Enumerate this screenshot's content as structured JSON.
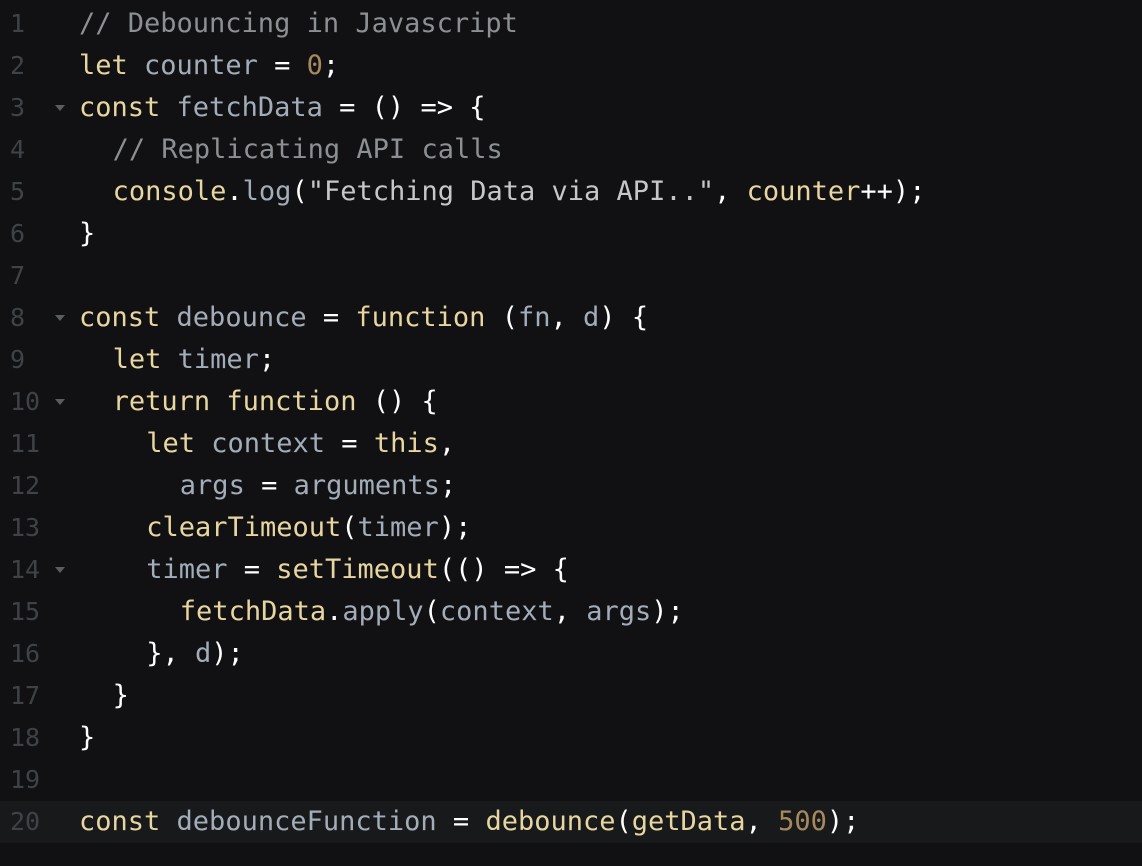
{
  "editor": {
    "language": "javascript",
    "active_line": 20,
    "fold_lines": [
      3,
      8,
      10,
      14
    ],
    "colors": {
      "background": "#111113",
      "keyword": "#e8d6a1",
      "identifier": "#a3acb9",
      "punctuation": "#ffffff",
      "comment": "#8c8f93",
      "number": "#a7895d",
      "gutter": "#3f4246"
    }
  },
  "lines": [
    {
      "n": "1",
      "indent": 0,
      "tokens": [
        {
          "t": "cm",
          "v": "// Debouncing in Javascript"
        }
      ]
    },
    {
      "n": "2",
      "indent": 0,
      "tokens": [
        {
          "t": "kw",
          "v": "let"
        },
        {
          "t": "sp",
          "v": " "
        },
        {
          "t": "var",
          "v": "counter"
        },
        {
          "t": "sp",
          "v": " "
        },
        {
          "t": "pn",
          "v": "="
        },
        {
          "t": "sp",
          "v": " "
        },
        {
          "t": "num",
          "v": "0"
        },
        {
          "t": "pn",
          "v": ";"
        }
      ]
    },
    {
      "n": "3",
      "indent": 0,
      "tokens": [
        {
          "t": "kw",
          "v": "const"
        },
        {
          "t": "sp",
          "v": " "
        },
        {
          "t": "var",
          "v": "fetchData"
        },
        {
          "t": "sp",
          "v": " "
        },
        {
          "t": "pn",
          "v": "="
        },
        {
          "t": "sp",
          "v": " "
        },
        {
          "t": "pn",
          "v": "()"
        },
        {
          "t": "sp",
          "v": " "
        },
        {
          "t": "pn",
          "v": "=>"
        },
        {
          "t": "sp",
          "v": " "
        },
        {
          "t": "pn",
          "v": "{"
        }
      ]
    },
    {
      "n": "4",
      "indent": 1,
      "tokens": [
        {
          "t": "cm",
          "v": "// Replicating API calls"
        }
      ]
    },
    {
      "n": "5",
      "indent": 1,
      "tokens": [
        {
          "t": "fn",
          "v": "console"
        },
        {
          "t": "pn",
          "v": "."
        },
        {
          "t": "prop",
          "v": "log"
        },
        {
          "t": "pn",
          "v": "("
        },
        {
          "t": "str",
          "v": "\"Fetching Data via API..\""
        },
        {
          "t": "pn",
          "v": ","
        },
        {
          "t": "sp",
          "v": " "
        },
        {
          "t": "fn",
          "v": "counter"
        },
        {
          "t": "pn",
          "v": "++);"
        }
      ]
    },
    {
      "n": "6",
      "indent": 0,
      "tokens": [
        {
          "t": "pn",
          "v": "}"
        }
      ]
    },
    {
      "n": "7",
      "indent": 0,
      "tokens": []
    },
    {
      "n": "8",
      "indent": 0,
      "tokens": [
        {
          "t": "kw",
          "v": "const"
        },
        {
          "t": "sp",
          "v": " "
        },
        {
          "t": "var",
          "v": "debounce"
        },
        {
          "t": "sp",
          "v": " "
        },
        {
          "t": "pn",
          "v": "="
        },
        {
          "t": "sp",
          "v": " "
        },
        {
          "t": "kw",
          "v": "function"
        },
        {
          "t": "sp",
          "v": " "
        },
        {
          "t": "pn",
          "v": "("
        },
        {
          "t": "var",
          "v": "fn"
        },
        {
          "t": "pn",
          "v": ","
        },
        {
          "t": "sp",
          "v": " "
        },
        {
          "t": "var",
          "v": "d"
        },
        {
          "t": "pn",
          "v": ")"
        },
        {
          "t": "sp",
          "v": " "
        },
        {
          "t": "pn",
          "v": "{"
        }
      ]
    },
    {
      "n": "9",
      "indent": 1,
      "tokens": [
        {
          "t": "kw",
          "v": "let"
        },
        {
          "t": "sp",
          "v": " "
        },
        {
          "t": "var",
          "v": "timer"
        },
        {
          "t": "pn",
          "v": ";"
        }
      ]
    },
    {
      "n": "10",
      "indent": 1,
      "tokens": [
        {
          "t": "kw",
          "v": "return"
        },
        {
          "t": "sp",
          "v": " "
        },
        {
          "t": "kw",
          "v": "function"
        },
        {
          "t": "sp",
          "v": " "
        },
        {
          "t": "pn",
          "v": "()"
        },
        {
          "t": "sp",
          "v": " "
        },
        {
          "t": "pn",
          "v": "{"
        }
      ]
    },
    {
      "n": "11",
      "indent": 2,
      "tokens": [
        {
          "t": "kw",
          "v": "let"
        },
        {
          "t": "sp",
          "v": " "
        },
        {
          "t": "var",
          "v": "context"
        },
        {
          "t": "sp",
          "v": " "
        },
        {
          "t": "pn",
          "v": "="
        },
        {
          "t": "sp",
          "v": " "
        },
        {
          "t": "kw",
          "v": "this"
        },
        {
          "t": "pn",
          "v": ","
        }
      ]
    },
    {
      "n": "12",
      "indent": 3,
      "tokens": [
        {
          "t": "var",
          "v": "args"
        },
        {
          "t": "sp",
          "v": " "
        },
        {
          "t": "pn",
          "v": "="
        },
        {
          "t": "sp",
          "v": " "
        },
        {
          "t": "var",
          "v": "arguments"
        },
        {
          "t": "pn",
          "v": ";"
        }
      ]
    },
    {
      "n": "13",
      "indent": 2,
      "tokens": [
        {
          "t": "fn",
          "v": "clearTimeout"
        },
        {
          "t": "pn",
          "v": "("
        },
        {
          "t": "var",
          "v": "timer"
        },
        {
          "t": "pn",
          "v": ");"
        }
      ]
    },
    {
      "n": "14",
      "indent": 2,
      "tokens": [
        {
          "t": "var",
          "v": "timer"
        },
        {
          "t": "sp",
          "v": " "
        },
        {
          "t": "pn",
          "v": "="
        },
        {
          "t": "sp",
          "v": " "
        },
        {
          "t": "fn",
          "v": "setTimeout"
        },
        {
          "t": "pn",
          "v": "(()"
        },
        {
          "t": "sp",
          "v": " "
        },
        {
          "t": "pn",
          "v": "=>"
        },
        {
          "t": "sp",
          "v": " "
        },
        {
          "t": "pn",
          "v": "{"
        }
      ]
    },
    {
      "n": "15",
      "indent": 3,
      "tokens": [
        {
          "t": "fn",
          "v": "fetchData"
        },
        {
          "t": "pn",
          "v": "."
        },
        {
          "t": "prop",
          "v": "apply"
        },
        {
          "t": "pn",
          "v": "("
        },
        {
          "t": "var",
          "v": "context"
        },
        {
          "t": "pn",
          "v": ","
        },
        {
          "t": "sp",
          "v": " "
        },
        {
          "t": "var",
          "v": "args"
        },
        {
          "t": "pn",
          "v": ");"
        }
      ]
    },
    {
      "n": "16",
      "indent": 2,
      "tokens": [
        {
          "t": "pn",
          "v": "},"
        },
        {
          "t": "sp",
          "v": " "
        },
        {
          "t": "var",
          "v": "d"
        },
        {
          "t": "pn",
          "v": ");"
        }
      ]
    },
    {
      "n": "17",
      "indent": 1,
      "tokens": [
        {
          "t": "pn",
          "v": "}"
        }
      ]
    },
    {
      "n": "18",
      "indent": 0,
      "tokens": [
        {
          "t": "pn",
          "v": "}"
        }
      ]
    },
    {
      "n": "19",
      "indent": 0,
      "tokens": []
    },
    {
      "n": "20",
      "indent": 0,
      "tokens": [
        {
          "t": "kw",
          "v": "const"
        },
        {
          "t": "sp",
          "v": " "
        },
        {
          "t": "var",
          "v": "debounceFunction"
        },
        {
          "t": "sp",
          "v": " "
        },
        {
          "t": "pn",
          "v": "="
        },
        {
          "t": "sp",
          "v": " "
        },
        {
          "t": "fn",
          "v": "debounce"
        },
        {
          "t": "pn",
          "v": "("
        },
        {
          "t": "fn",
          "v": "getData"
        },
        {
          "t": "pn",
          "v": ","
        },
        {
          "t": "sp",
          "v": " "
        },
        {
          "t": "num",
          "v": "500"
        },
        {
          "t": "pn",
          "v": ");"
        }
      ]
    }
  ]
}
